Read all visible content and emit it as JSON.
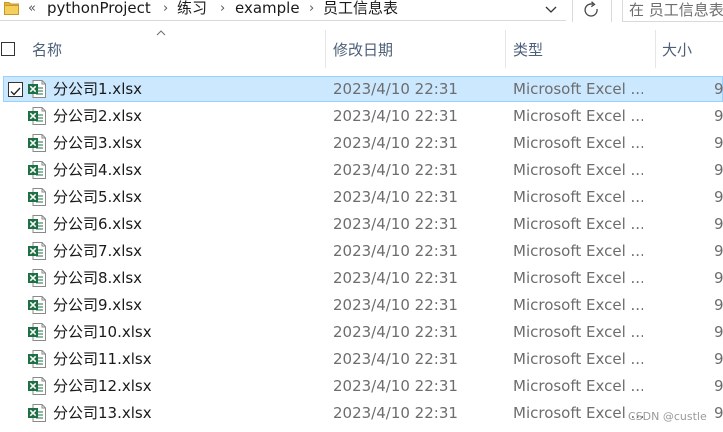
{
  "address": {
    "overflow_label": "«",
    "breadcrumbs": [
      "pythonProject",
      "练习",
      "example",
      "员工信息表"
    ],
    "separator": "›",
    "refresh_glyph": "↻"
  },
  "search": {
    "placeholder": "在 员工信息表"
  },
  "columns": {
    "name": "名称",
    "date": "修改日期",
    "type": "类型",
    "size": "大小"
  },
  "files": [
    {
      "name": "分公司1.xlsx",
      "date": "2023/4/10 22:31",
      "type": "Microsoft Excel ...",
      "size": "9",
      "selected": true
    },
    {
      "name": "分公司2.xlsx",
      "date": "2023/4/10 22:31",
      "type": "Microsoft Excel ...",
      "size": "9",
      "selected": false
    },
    {
      "name": "分公司3.xlsx",
      "date": "2023/4/10 22:31",
      "type": "Microsoft Excel ...",
      "size": "9",
      "selected": false
    },
    {
      "name": "分公司4.xlsx",
      "date": "2023/4/10 22:31",
      "type": "Microsoft Excel ...",
      "size": "9",
      "selected": false
    },
    {
      "name": "分公司5.xlsx",
      "date": "2023/4/10 22:31",
      "type": "Microsoft Excel ...",
      "size": "9",
      "selected": false
    },
    {
      "name": "分公司6.xlsx",
      "date": "2023/4/10 22:31",
      "type": "Microsoft Excel ...",
      "size": "9",
      "selected": false
    },
    {
      "name": "分公司7.xlsx",
      "date": "2023/4/10 22:31",
      "type": "Microsoft Excel ...",
      "size": "9",
      "selected": false
    },
    {
      "name": "分公司8.xlsx",
      "date": "2023/4/10 22:31",
      "type": "Microsoft Excel ...",
      "size": "9",
      "selected": false
    },
    {
      "name": "分公司9.xlsx",
      "date": "2023/4/10 22:31",
      "type": "Microsoft Excel ...",
      "size": "9",
      "selected": false
    },
    {
      "name": "分公司10.xlsx",
      "date": "2023/4/10 22:31",
      "type": "Microsoft Excel ...",
      "size": "9",
      "selected": false
    },
    {
      "name": "分公司11.xlsx",
      "date": "2023/4/10 22:31",
      "type": "Microsoft Excel ...",
      "size": "9",
      "selected": false
    },
    {
      "name": "分公司12.xlsx",
      "date": "2023/4/10 22:31",
      "type": "Microsoft Excel ...",
      "size": "9",
      "selected": false
    },
    {
      "name": "分公司13.xlsx",
      "date": "2023/4/10 22:31",
      "type": "Microsoft Excel ...",
      "size": "9",
      "selected": false
    }
  ],
  "watermark": "CSDN @custle",
  "colors": {
    "selection_bg": "#cce8ff",
    "selection_border": "#99d1ff",
    "header_text": "#4c607a",
    "excel_green": "#1d7044"
  },
  "icons": {
    "folder": "folder-icon",
    "file": "excel-file-icon",
    "dropdown": "chevron-down-icon",
    "refresh": "refresh-icon",
    "sort": "sort-ascending-icon"
  }
}
